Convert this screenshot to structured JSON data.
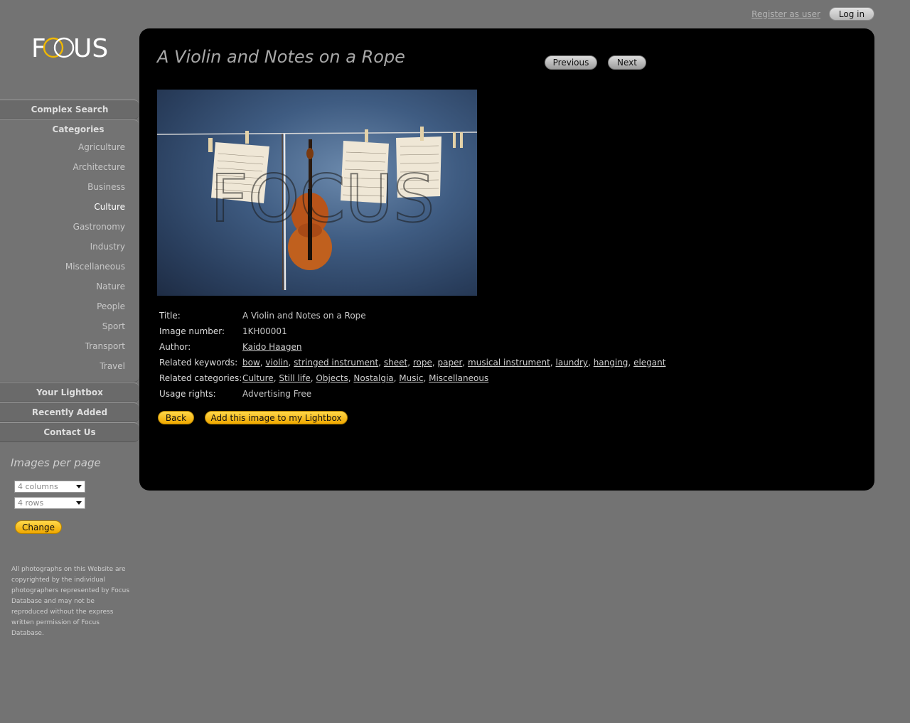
{
  "header": {
    "register_label": "Register as user",
    "login_label": "Log in"
  },
  "logo": {
    "text": "FOCUS",
    "accent_color": "#f0b800"
  },
  "sidebar": {
    "complex_search": "Complex Search",
    "categories_title": "Categories",
    "categories": [
      "Agriculture",
      "Architecture",
      "Business",
      "Culture",
      "Gastronomy",
      "Industry",
      "Miscellaneous",
      "Nature",
      "People",
      "Sport",
      "Transport",
      "Travel"
    ],
    "active_category": "Culture",
    "your_lightbox": "Your Lightbox",
    "recently_added": "Recently Added",
    "contact_us": "Contact Us",
    "images_per_page_title": "Images per page",
    "columns_select": "4 columns",
    "rows_select": "4 rows",
    "change_label": "Change",
    "copyright": "All photographs on this Website are copyrighted by the individual photographers represented by Focus Database and may not be reproduced without the express written permission of Focus Database."
  },
  "main": {
    "title": "A Violin and Notes on a Rope",
    "previous_label": "Previous",
    "next_label": "Next",
    "watermark": "FOCUS",
    "info": {
      "title_label": "Title:",
      "title_value": "A Violin and Notes on a Rope",
      "number_label": "Image number:",
      "number_value": "1KH00001",
      "author_label": "Author:",
      "author_value": "Kaido Haagen",
      "keywords_label": "Related keywords:",
      "keywords": [
        "bow",
        "violin",
        "stringed instrument",
        "sheet",
        "rope",
        "paper",
        "musical instrument",
        "laundry",
        "hanging",
        "elegant"
      ],
      "categories_label": "Related categories:",
      "categories": [
        "Culture",
        "Still life",
        "Objects",
        "Nostalgia",
        "Music",
        "Miscellaneous"
      ],
      "usage_label": "Usage rights:",
      "usage_value": "Advertising Free"
    },
    "back_label": "Back",
    "add_label": "Add this image to my Lightbox"
  }
}
